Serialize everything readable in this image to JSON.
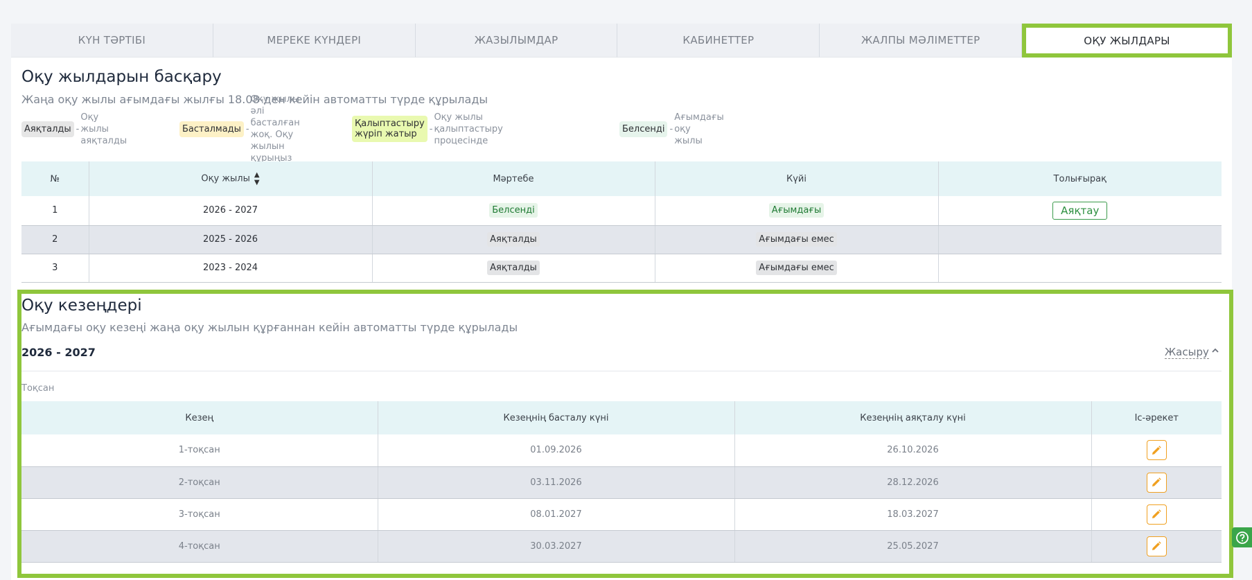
{
  "tabs": [
    {
      "label": "КҮН ТӘРТІБІ"
    },
    {
      "label": "МЕРЕКЕ КҮНДЕРІ"
    },
    {
      "label": "ЖАЗЫЛЫМДАР"
    },
    {
      "label": "КАБИНЕТТЕР"
    },
    {
      "label": "ЖАЛПЫ МӘЛІМЕТТЕР"
    },
    {
      "label": "ОҚУ ЖЫЛДАРЫ"
    }
  ],
  "years": {
    "title": "Оқу жылдарын басқару",
    "subtitle": "Жаңа оқу жылы ағымдағы жылғы 18.08-ден кейін автоматты түрде құрылады",
    "legend": [
      {
        "badge": "Аяқталды",
        "desc": "Оқу жылы аяқталды",
        "color": "#e6e6e6"
      },
      {
        "badge": "Басталмады",
        "desc_lines": [
          "Оқу жылы әлі",
          "басталған жоқ. Оқу",
          "жылын құрыңыз"
        ],
        "color": "#fdf1c6"
      },
      {
        "badge": "Қалыптастыру жүріп жатыр",
        "desc_lines": [
          "Оқу жылы қалыптастыру",
          "процесінде"
        ],
        "color": "#e9f9b0"
      },
      {
        "badge": "Белсенді",
        "desc_lines": [
          "Ағымдағы оқу",
          "жылы"
        ],
        "color": "#e6f4ec"
      }
    ],
    "dash": "-",
    "columns": [
      "№",
      "Оқу жылы",
      "Мәртебе",
      "Күйі",
      "Толығырақ"
    ],
    "rows": [
      {
        "num": "1",
        "year": "2026 - 2027",
        "status": "Белсенді",
        "state": "Ағымдағы",
        "action": "Аяқтау"
      },
      {
        "num": "2",
        "year": "2025 - 2026",
        "status": "Аяқталды",
        "state": "Ағымдағы емес",
        "action": ""
      },
      {
        "num": "3",
        "year": "2023 - 2024",
        "status": "Аяқталды",
        "state": "Ағымдағы емес",
        "action": ""
      }
    ]
  },
  "periods": {
    "title": "Оқу кезеңдері",
    "subtitle": "Ағымдағы оқу кезеңі жаңа оқу жылын құрғаннан кейін автоматты түрде құрылады",
    "year": "2026 - 2027",
    "hide_label": "Жасыру",
    "group_label": "Тоқсан",
    "columns": [
      "Кезең",
      "Кезеңнің басталу күні",
      "Кезеңнің аяқталу күні",
      "Іс-әрекет"
    ],
    "rows": [
      {
        "period": "1-тоқсан",
        "start": "01.09.2026",
        "end": "26.10.2026"
      },
      {
        "period": "2-тоқсан",
        "start": "03.11.2026",
        "end": "28.12.2026"
      },
      {
        "period": "3-тоқсан",
        "start": "08.01.2027",
        "end": "18.03.2027"
      },
      {
        "period": "4-тоқсан",
        "start": "30.03.2027",
        "end": "25.05.2027"
      }
    ]
  },
  "colors": {
    "accent_green": "#8fc63c",
    "edit_orange": "#f0a020"
  }
}
